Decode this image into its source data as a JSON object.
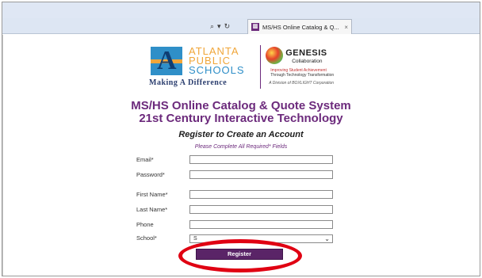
{
  "browser": {
    "search_icon": "search-icon",
    "dropdown_glyph": "▾",
    "refresh_icon": "refresh-icon",
    "tab_title": "MS/HS Online Catalog & Q...",
    "tab_close": "×"
  },
  "logos": {
    "aps_lines": [
      "ATLANTA",
      "PUBLIC",
      "SCHOOLS"
    ],
    "aps_tagline": "Making A Difference",
    "genesis_title": "GENESIS",
    "genesis_sub": "Collaboration",
    "genesis_line1": "Improving Student Achievement",
    "genesis_line2": "Through Technology Transformation",
    "genesis_line3": "A Division of BOXLIGHT Corporation"
  },
  "page": {
    "title_line1": "MS/HS Online Catalog & Quote System",
    "title_line2": "21st Century Interactive Technology",
    "form_heading": "Register to Create an Account",
    "form_note": "Please Complete All Required* Fields"
  },
  "form": {
    "fields": [
      {
        "label": "Email*",
        "value": ""
      },
      {
        "label": "Password*",
        "value": ""
      },
      {
        "label": "First Name*",
        "value": ""
      },
      {
        "label": "Last Name*",
        "value": ""
      },
      {
        "label": "Phone",
        "value": ""
      }
    ],
    "school_label": "School*",
    "school_value": "S",
    "register_label": "Register"
  },
  "colors": {
    "accent": "#6c2a7c",
    "button": "#5a2467",
    "highlight": "#e00012"
  }
}
